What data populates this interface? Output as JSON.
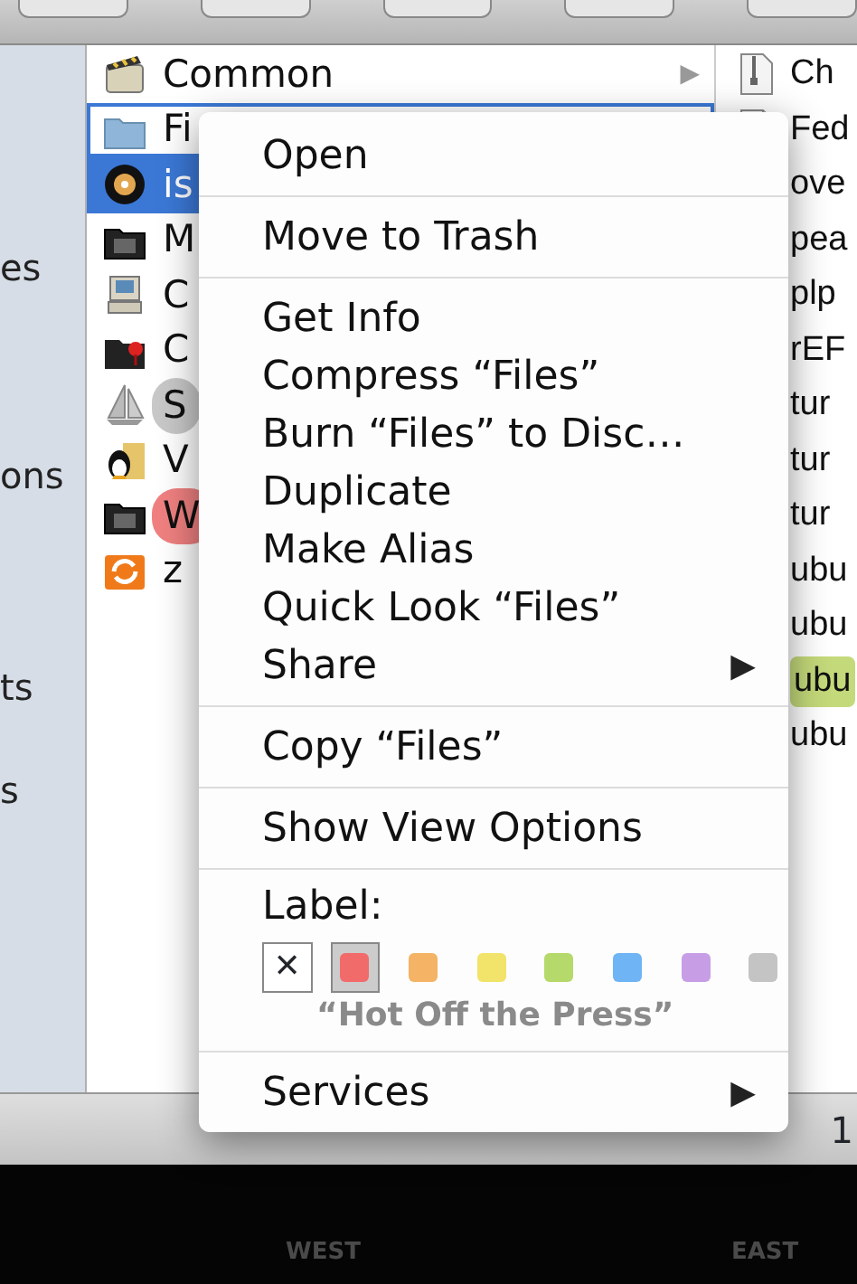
{
  "sidebar": {
    "items": [
      "es",
      "ons",
      "ts",
      "s"
    ]
  },
  "column_1": [
    {
      "name": "Common",
      "kind": "clapper",
      "selected": false,
      "focused": false,
      "arrow": "▶"
    },
    {
      "name": "Fi",
      "kind": "folder",
      "selected": false,
      "focused": true
    },
    {
      "name": "is",
      "kind": "disc",
      "selected": true,
      "focused": false
    },
    {
      "name": "M",
      "kind": "darkfolder",
      "selected": false,
      "focused": false
    },
    {
      "name": "C",
      "kind": "computer",
      "selected": false,
      "focused": false
    },
    {
      "name": "C",
      "kind": "pinfolder",
      "selected": false,
      "focused": false
    },
    {
      "name": "S",
      "kind": "app",
      "selected": false,
      "focused": false,
      "color": "#c8c8c8"
    },
    {
      "name": "V",
      "kind": "penguin",
      "selected": false,
      "focused": false
    },
    {
      "name": "W",
      "kind": "darkfolder",
      "selected": false,
      "focused": false,
      "color": "#f08080"
    },
    {
      "name": "z",
      "kind": "orange",
      "selected": false,
      "focused": false
    }
  ],
  "column_2": [
    {
      "name": "Ch",
      "kind": "zip",
      "selected": false
    },
    {
      "name": "Fed",
      "kind": "doc",
      "selected": false
    },
    {
      "name": "ove",
      "kind": "none",
      "selected": false
    },
    {
      "name": "pea",
      "kind": "none",
      "selected": false
    },
    {
      "name": "plp",
      "kind": "none",
      "selected": false
    },
    {
      "name": "rEF",
      "kind": "none",
      "selected": false
    },
    {
      "name": "tur",
      "kind": "none",
      "selected": false
    },
    {
      "name": "tur",
      "kind": "none",
      "selected": false
    },
    {
      "name": "tur",
      "kind": "none",
      "selected": false
    },
    {
      "name": "ubu",
      "kind": "none",
      "selected": false
    },
    {
      "name": "ubu",
      "kind": "none",
      "selected": false
    },
    {
      "name": "ubu",
      "kind": "none",
      "selected": true,
      "color": "#c4d97a"
    },
    {
      "name": "ubu",
      "kind": "none",
      "selected": false
    }
  ],
  "status_bar": {
    "text": "1"
  },
  "footer": {
    "texts": [
      "WEST",
      "EAST"
    ]
  },
  "context_menu": {
    "sections": [
      [
        {
          "label": "Open"
        }
      ],
      [
        {
          "label": "Move to Trash"
        }
      ],
      [
        {
          "label": "Get Info"
        },
        {
          "label": "Compress “Files”"
        },
        {
          "label": "Burn “Files” to Disc…"
        },
        {
          "label": "Duplicate"
        },
        {
          "label": "Make Alias"
        },
        {
          "label": "Quick Look “Files”"
        },
        {
          "label": "Share",
          "submenu_arrow": "▶"
        }
      ],
      [
        {
          "label": "Copy “Files”"
        }
      ],
      [
        {
          "label": "Show View Options"
        }
      ]
    ],
    "label": {
      "title": "Label:",
      "swatches": [
        {
          "kind": "none",
          "symbol": "✕",
          "selected": false
        },
        {
          "kind": "color",
          "color": "#f26b6b",
          "selected": true
        },
        {
          "kind": "color",
          "color": "#f5b365",
          "selected": false
        },
        {
          "kind": "color",
          "color": "#f2e36a",
          "selected": false
        },
        {
          "kind": "color",
          "color": "#b5d96b",
          "selected": false
        },
        {
          "kind": "color",
          "color": "#6fb4f5",
          "selected": false
        },
        {
          "kind": "color",
          "color": "#c79ee6",
          "selected": false
        },
        {
          "kind": "color",
          "color": "#c4c4c4",
          "selected": false
        }
      ],
      "caption": "“Hot Off the Press”"
    },
    "services": {
      "label": "Services",
      "submenu_arrow": "▶"
    }
  }
}
